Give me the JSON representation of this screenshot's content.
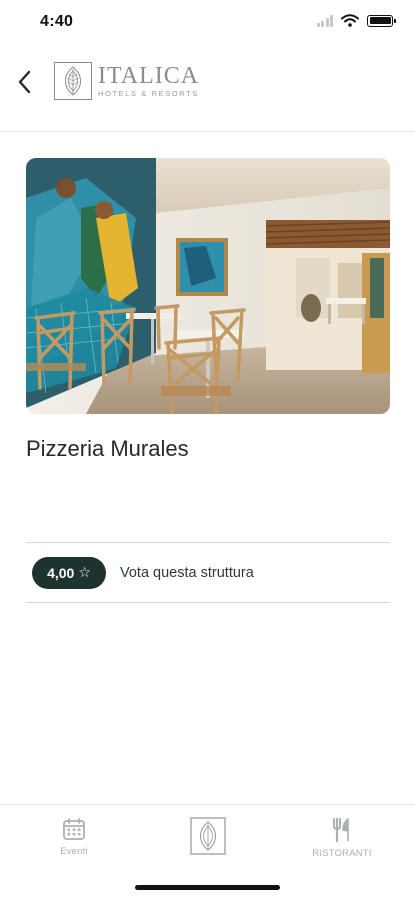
{
  "status_bar": {
    "time": "4:40"
  },
  "header": {
    "brand_name": "ITALICA",
    "brand_tagline": "HOTELS & RESORTS"
  },
  "place": {
    "name": "Pizzeria Murales",
    "rating": "4,00",
    "rating_star": "☆",
    "rate_label": "Vota questa struttura"
  },
  "tab_bar": {
    "events_label": "Eventi",
    "restaurants_label": "RISTORANTI"
  },
  "colors": {
    "badge": "#1e3330",
    "tab_inactive": "#a9b1b4"
  }
}
